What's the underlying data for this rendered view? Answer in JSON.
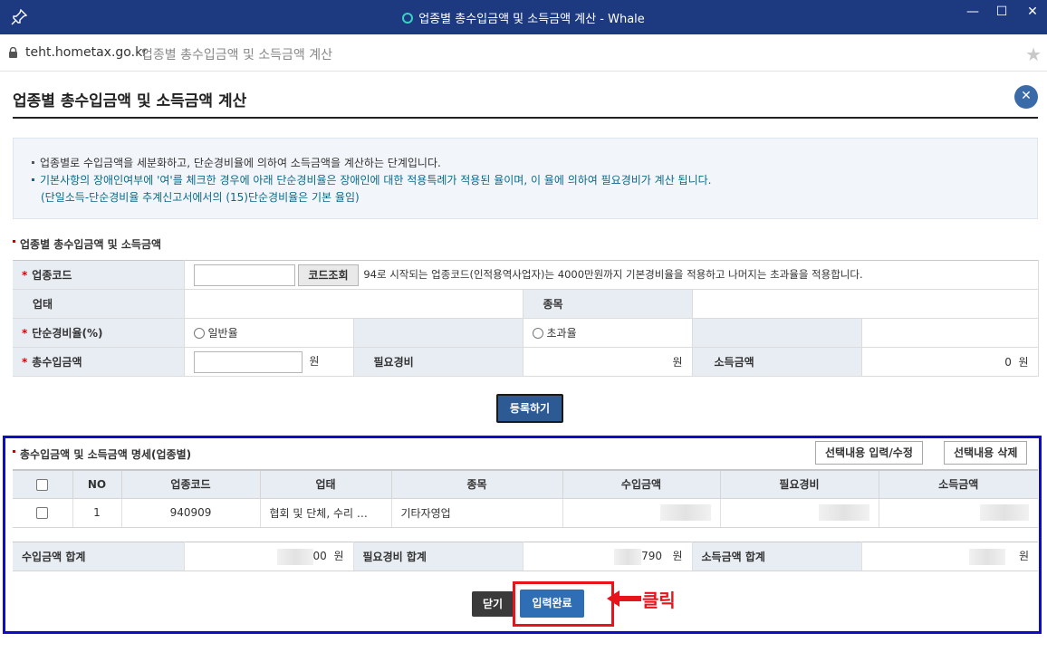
{
  "window": {
    "title": "업종별 총수입금액 및 소득금액 계산 - Whale",
    "minimize": "—",
    "maximize": "☐",
    "close": "✕"
  },
  "address": {
    "url": "teht.hometax.go.kr",
    "page_title": "업종별 총수입금액 및 소득금액 계산"
  },
  "popup": {
    "title": "업종별 총수입금액 및 소득금액 계산",
    "close": "✕"
  },
  "info": {
    "line1": "업종별로 수입금액을 세분화하고, 단순경비율에 의하여 소득금액을 계산하는 단계입니다.",
    "line2": "기본사항의 장애인여부에 '여'를 체크한 경우에 아래 단순경비율은 장애인에 대한 적용특례가 적용된 율이며, 이 율에 의하여 필요경비가 계산 됩니다.",
    "line3": "(단일소득-단순경비율 추계신고서에서의 (15)단순경비율은 기본 율임)"
  },
  "form": {
    "section_title": "업종별 총수입금액 및 소득금액",
    "required_mark": "*",
    "industry_code_label": "업종코드",
    "code_lookup_button": "코드조회",
    "code_hint": "94로 시작되는 업종코드(인적용역사업자)는 4000만원까지 기본경비율을 적용하고 나머지는 초과율을 적용합니다.",
    "business_type_label": "업태",
    "business_item_label": "종목",
    "simple_rate_label": "단순경비율(%)",
    "normal_rate_option": "일반율",
    "excess_rate_option": "초과율",
    "total_income_label": "총수입금액",
    "won": "원",
    "necessary_expense_label": "필요경비",
    "income_amount_label": "소득금액",
    "income_amount_value": "0",
    "register_button": "등록하기"
  },
  "detail": {
    "section_title": "총수입금액 및 소득금액 명세(업종별)",
    "edit_button": "선택내용 입력/수정",
    "delete_button": "선택내용 삭제",
    "columns": [
      "NO",
      "업종코드",
      "업태",
      "종목",
      "수입금액",
      "필요경비",
      "소득금액"
    ],
    "rows": [
      {
        "no": "1",
        "code": "940909",
        "business_type": "협회 및 단체, 수리 …",
        "business_item": "기타자영업"
      }
    ]
  },
  "summary": {
    "income_total_label": "수입금액 합계",
    "income_total_suffix": "00",
    "expense_total_label": "필요경비 합계",
    "expense_total_suffix": "790",
    "income_amount_total_label": "소득금액 합계",
    "won": "원"
  },
  "footer": {
    "close_button": "닫기",
    "complete_button": "입력완료",
    "annotation": "클릭"
  },
  "colors": {
    "titlebar": "#1d3a80",
    "highlight_frame": "#0d0dc8",
    "annotation_red": "#e8141b",
    "primary_button": "#2f6db5"
  }
}
